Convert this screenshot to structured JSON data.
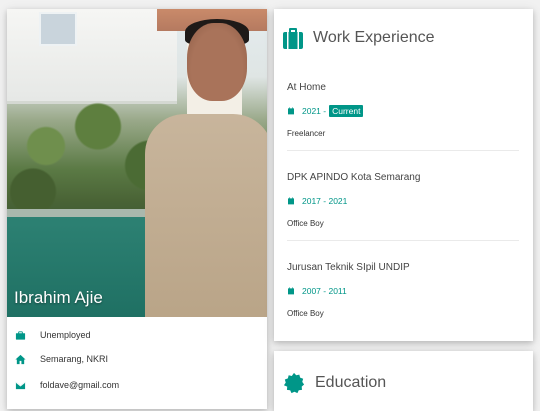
{
  "profile": {
    "name": "Ibrahim Ajie",
    "job": "Unemployed",
    "location": "Semarang, NKRI",
    "email": "foldave@gmail.com"
  },
  "work": {
    "title": "Work Experience",
    "jobs": [
      {
        "title": "At Home",
        "start": "2021 - ",
        "badge": "Current",
        "end": "",
        "role": "Freelancer"
      },
      {
        "title": "DPK APINDO Kota Semarang",
        "start": "2017 - 2021",
        "badge": "",
        "end": "",
        "role": "Office Boy"
      },
      {
        "title": "Jurusan Teknik SIpil UNDIP",
        "start": "2007 - 2011",
        "badge": "",
        "end": "",
        "role": "Office Boy"
      }
    ]
  },
  "education": {
    "title": "Education"
  },
  "colors": {
    "accent": "#009688"
  },
  "icons": [
    "briefcase-icon",
    "home-icon",
    "envelope-icon",
    "suitcase-icon",
    "calendar-icon",
    "certificate-icon"
  ]
}
